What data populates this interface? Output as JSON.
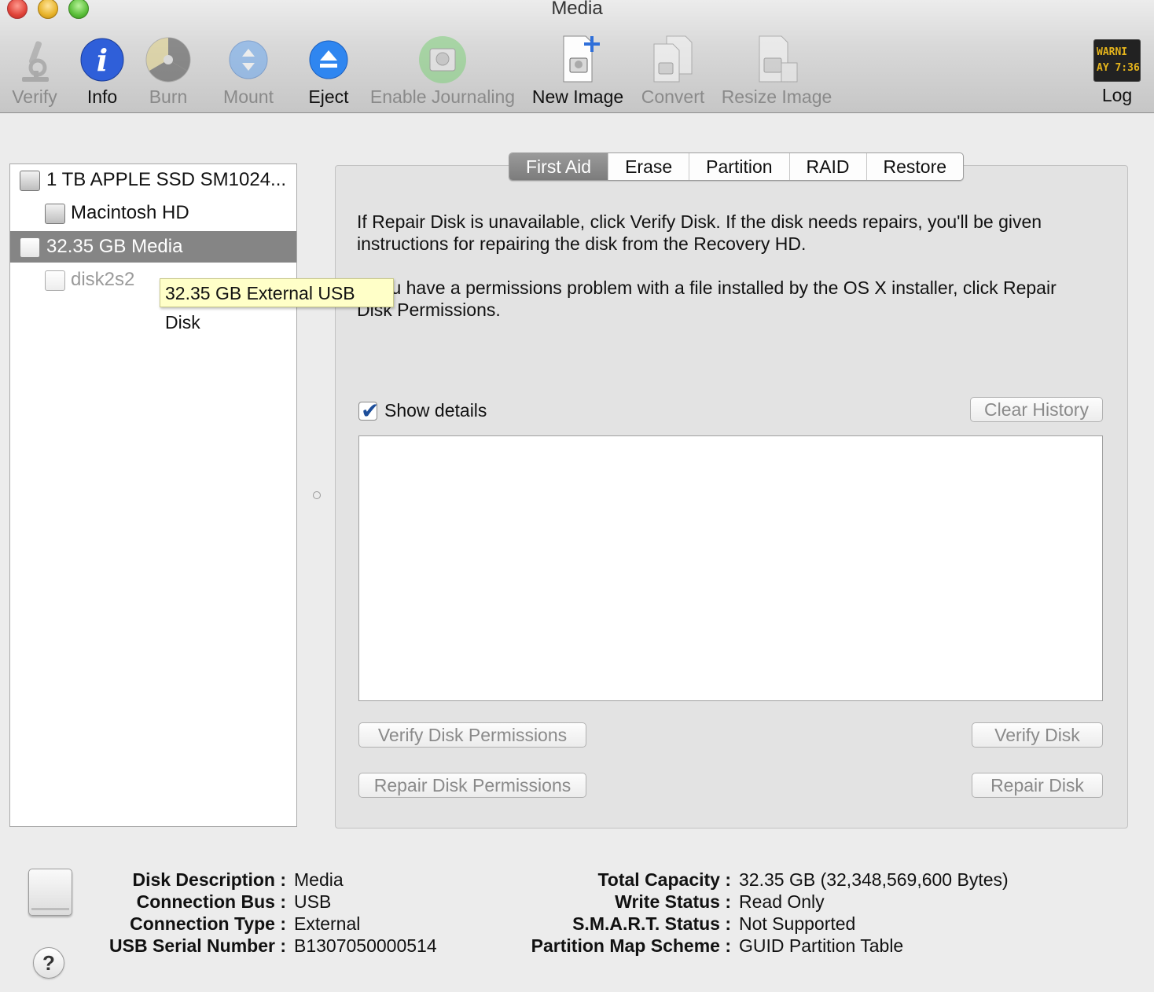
{
  "window": {
    "title": "Media"
  },
  "toolbar": {
    "verify": "Verify",
    "info": "Info",
    "burn": "Burn",
    "mount": "Mount",
    "eject": "Eject",
    "enable_journaling": "Enable Journaling",
    "new_image": "New Image",
    "convert": "Convert",
    "resize_image": "Resize Image",
    "log": "Log",
    "log_icon_text": "WARNI\nAY 7:36"
  },
  "sidebar": {
    "items": [
      {
        "label": "1 TB APPLE SSD SM1024..."
      },
      {
        "label": "Macintosh HD"
      },
      {
        "label": "32.35 GB Media"
      },
      {
        "label": "disk2s2"
      }
    ],
    "tooltip": "32.35 GB External USB Disk"
  },
  "tabs": [
    "First Aid",
    "Erase",
    "Partition",
    "RAID",
    "Restore"
  ],
  "first_aid": {
    "para1_line1": "If Repair Disk is unavailable, click Verify Disk. If the disk needs repairs, you'll be given",
    "para1_line2": "instructions for repairing the disk from the Recovery HD.",
    "para2_line1": "If you have a permissions problem with a file installed by the OS X installer, click Repair",
    "para2_line2": "Disk Permissions.",
    "show_details": "Show details",
    "clear_history": "Clear History",
    "verify_disk_permissions": "Verify Disk Permissions",
    "repair_disk_permissions": "Repair Disk Permissions",
    "verify_disk": "Verify Disk",
    "repair_disk": "Repair Disk"
  },
  "disk_info": {
    "left": [
      {
        "label": "Disk Description :",
        "value": "Media"
      },
      {
        "label": "Connection Bus :",
        "value": "USB"
      },
      {
        "label": "Connection Type :",
        "value": "External"
      },
      {
        "label": "USB Serial Number :",
        "value": "B1307050000514"
      }
    ],
    "right": [
      {
        "label": "Total Capacity :",
        "value": "32.35 GB (32,348,569,600 Bytes)"
      },
      {
        "label": "Write Status :",
        "value": "Read Only"
      },
      {
        "label": "S.M.A.R.T. Status :",
        "value": "Not Supported"
      },
      {
        "label": "Partition Map Scheme :",
        "value": "GUID Partition Table"
      }
    ]
  },
  "help_symbol": "?",
  "checkmark": "✔"
}
